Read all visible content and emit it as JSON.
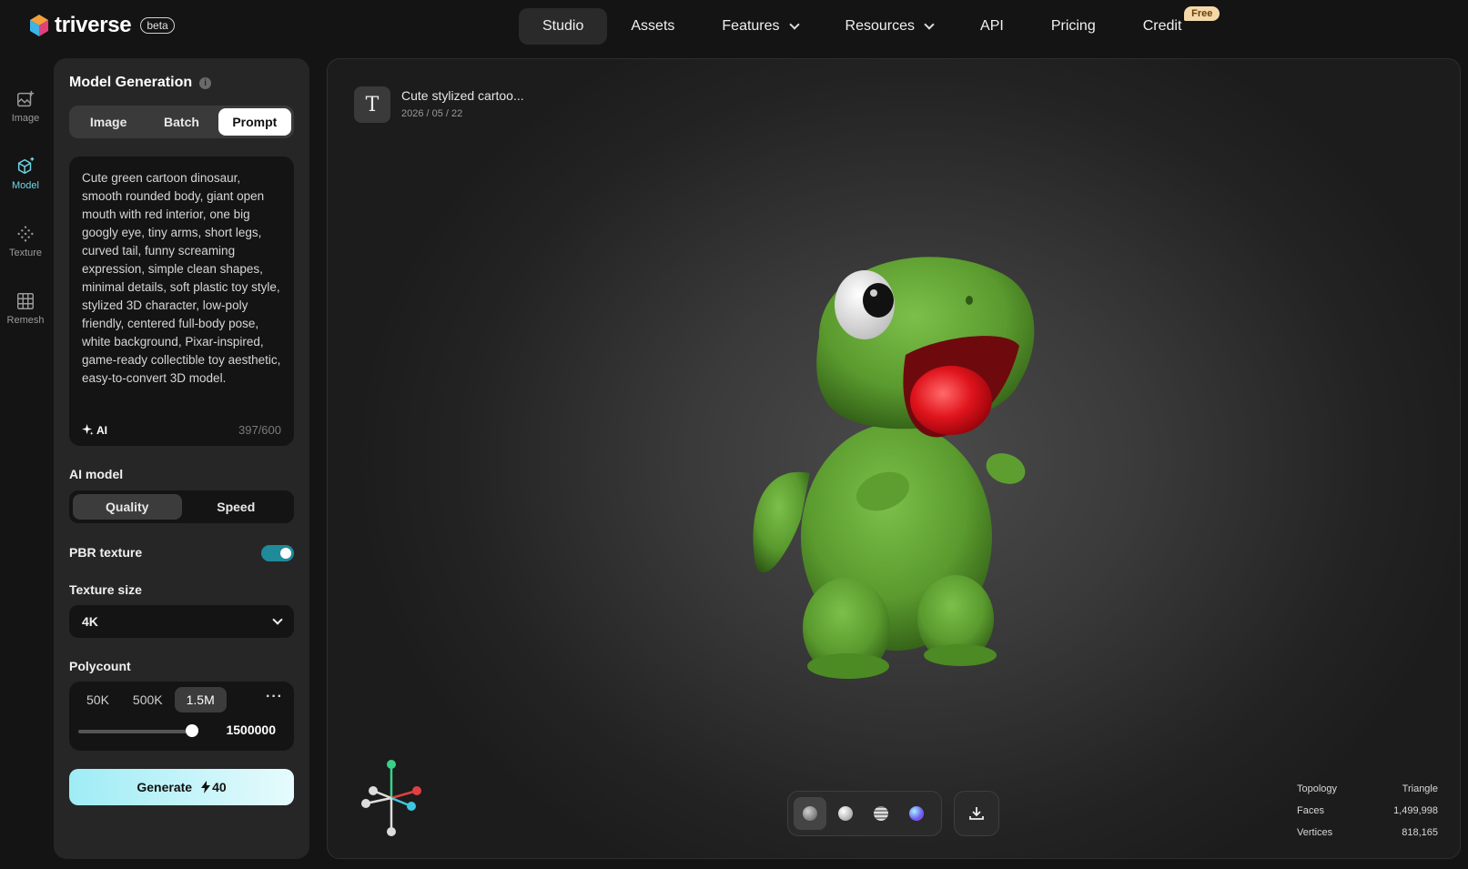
{
  "brand": {
    "name": "triverse",
    "badge": "beta"
  },
  "nav": {
    "items": [
      {
        "label": "Studio"
      },
      {
        "label": "Assets"
      },
      {
        "label": "Features"
      },
      {
        "label": "Resources"
      },
      {
        "label": "API"
      },
      {
        "label": "Pricing"
      },
      {
        "label": "Credit"
      }
    ],
    "credit_badge": "Free"
  },
  "rail": {
    "items": [
      {
        "label": "Image",
        "icon": "image-plus-icon"
      },
      {
        "label": "Model",
        "icon": "cube-sparkle-icon"
      },
      {
        "label": "Texture",
        "icon": "texture-dots-icon"
      },
      {
        "label": "Remesh",
        "icon": "grid-icon"
      }
    ]
  },
  "panel": {
    "title": "Model Generation",
    "info_glyph": "i",
    "tabs": [
      {
        "label": "Image"
      },
      {
        "label": "Batch"
      },
      {
        "label": "Prompt"
      }
    ],
    "prompt": {
      "text": "Cute green cartoon dinosaur, smooth rounded body, giant open mouth with red interior, one big googly eye, tiny arms, short legs, curved tail, funny screaming expression, simple clean shapes, minimal details, soft plastic toy style, stylized 3D character, low-poly friendly, centered full-body pose, white background, Pixar-inspired, game-ready collectible toy aesthetic, easy-to-convert 3D model.",
      "ai_label": "AI",
      "counter": "397/600"
    },
    "ai_model": {
      "label": "AI model",
      "options": [
        {
          "label": "Quality"
        },
        {
          "label": "Speed"
        }
      ]
    },
    "pbr": {
      "label": "PBR texture",
      "enabled": true
    },
    "texture_size": {
      "label": "Texture size",
      "value": "4K"
    },
    "polycount": {
      "label": "Polycount",
      "options": [
        {
          "label": "50K"
        },
        {
          "label": "500K"
        },
        {
          "label": "1.5M"
        }
      ],
      "more": "···",
      "value": "1500000"
    },
    "generate": {
      "label": "Generate",
      "cost": "40"
    }
  },
  "viewport": {
    "doc_icon_glyph": "T",
    "title": "Cute stylized cartoo...",
    "date": "2026 / 05 / 22",
    "stats": [
      {
        "label": "Topology",
        "value": "Triangle"
      },
      {
        "label": "Faces",
        "value": "1,499,998"
      },
      {
        "label": "Vertices",
        "value": "818,165"
      }
    ]
  },
  "colors": {
    "accent": "#6fd6e3",
    "toggle": "#1f8a99",
    "generate_start": "#9fecf5",
    "dino_green": "#5a9a2e",
    "mouth_red": "#e0141c"
  }
}
